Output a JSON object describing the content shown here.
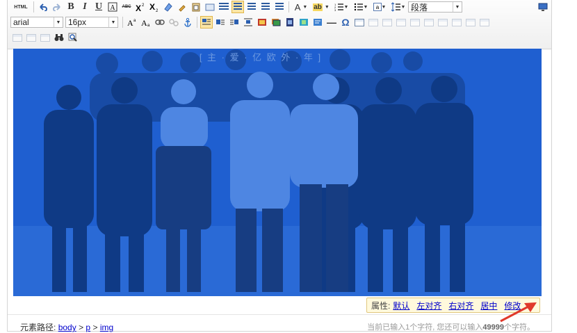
{
  "toolbar": {
    "row1": {
      "html": "HTML",
      "bold": "B",
      "italic": "I",
      "underline": "U",
      "strike": "ABC",
      "font_color": "A",
      "highlight": "ab",
      "paragraph_value": "段落"
    },
    "row2": {
      "font_family_value": "arial",
      "font_size_value": "16px",
      "special_char": "Ω",
      "horizontal_rule": "—"
    }
  },
  "photo": {
    "caption": "[ 主 · 爱 · 亿 欧 外 · 年 ]"
  },
  "popup": {
    "label": "属性:",
    "links": [
      "默认",
      "左对齐",
      "右对齐",
      "居中",
      "修改"
    ]
  },
  "status": {
    "path_label": "元素路径:",
    "path": [
      "body",
      "p",
      "img"
    ],
    "path_sep": ">",
    "counter_prefix": "当前已输入1个字符, 您还可以输入",
    "counter_remaining": "49999",
    "counter_suffix": "个字符。"
  },
  "colors": {
    "photo_tint": "#1f5fd0",
    "popup_bg": "#fff9dc",
    "link": "#0000cc",
    "arrow": "#e0392b"
  }
}
